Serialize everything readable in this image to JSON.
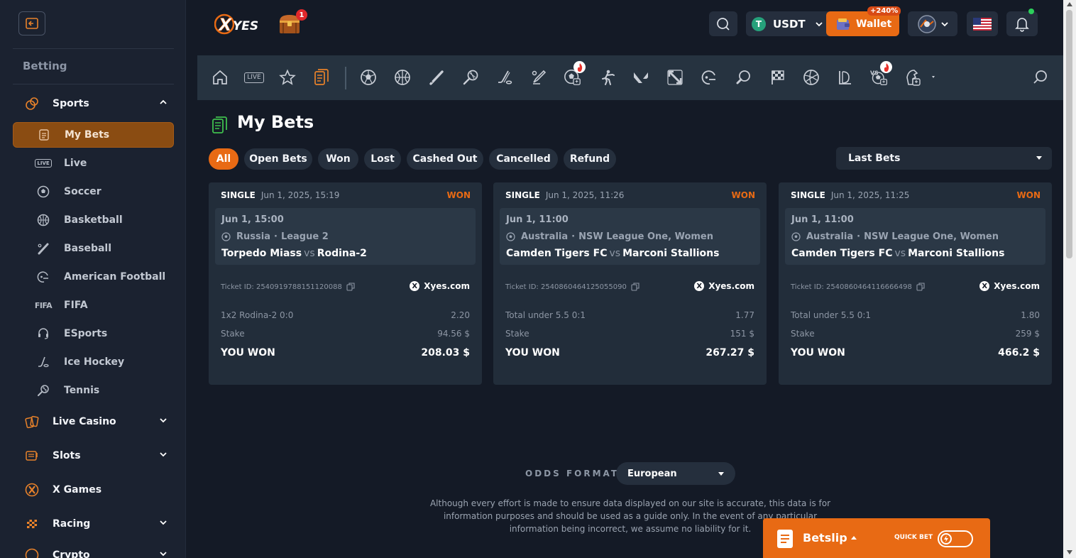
{
  "brand": {
    "logo_text": "XYES",
    "chest_badge": "1"
  },
  "sidebar": {
    "heading": "Betting",
    "sports_group": {
      "label": "Sports",
      "icon": "sports-icon",
      "expanded": true
    },
    "sport_items": [
      {
        "label": "My Bets",
        "icon": "bets-icon",
        "active": true
      },
      {
        "label": "Live",
        "icon": "live-icon",
        "badge": "LIVE"
      },
      {
        "label": "Soccer",
        "icon": "soccer-icon"
      },
      {
        "label": "Basketball",
        "icon": "basketball-icon"
      },
      {
        "label": "Baseball",
        "icon": "baseball-icon"
      },
      {
        "label": "American Football",
        "icon": "american-football-icon"
      },
      {
        "label": "FIFA",
        "icon": "fifa-icon",
        "badge": "FIFA"
      },
      {
        "label": "ESports",
        "icon": "esports-icon"
      },
      {
        "label": "Ice Hockey",
        "icon": "ice-hockey-icon"
      },
      {
        "label": "Tennis",
        "icon": "tennis-icon"
      }
    ],
    "groups": [
      {
        "label": "Live Casino",
        "icon": "live-casino-icon",
        "chevron": true
      },
      {
        "label": "Slots",
        "icon": "slots-icon",
        "chevron": true
      },
      {
        "label": "X Games",
        "icon": "x-games-icon",
        "chevron": false
      },
      {
        "label": "Racing",
        "icon": "racing-icon",
        "chevron": true
      },
      {
        "label": "Crypto",
        "icon": "crypto-icon",
        "chevron": true
      }
    ]
  },
  "topbar": {
    "currency": "USDT",
    "currency_symbol": "T",
    "wallet_label": "Wallet",
    "wallet_bonus": "+240%",
    "accent": "#e86a14"
  },
  "sports_bar": {
    "items": [
      "home-icon",
      "live-icon",
      "favorites-icon",
      "my-bets-icon",
      "soccer-icon",
      "basketball-icon",
      "baseball-icon",
      "tennis-icon",
      "ice-hockey-icon",
      "cricket-icon",
      "virtual-soccer-icon",
      "shooter-icon",
      "valorant-icon",
      "dota-icon",
      "american-football-icon",
      "table-tennis-icon",
      "racing-flag-icon",
      "volleyball-icon",
      "handball-icon",
      "virtual-sports-icon",
      "more-sports-icon"
    ],
    "live_label": "LIVE"
  },
  "page": {
    "title": "My Bets",
    "filters": [
      "All",
      "Open Bets",
      "Won",
      "Lost",
      "Cashed Out",
      "Cancelled",
      "Refund"
    ],
    "active_filter": "All",
    "period_select": "Last Bets"
  },
  "bets": [
    {
      "type": "SINGLE",
      "placed": "Jun 1, 2025, 15:19",
      "status": "WON",
      "event_time": "Jun 1, 15:00",
      "country": "Russia",
      "league": "League 2",
      "home": "Torpedo Miass",
      "vs": "vs",
      "away": "Rodina-2",
      "ticket": "Ticket ID: 2540919788151120088",
      "site": "Xyes.com",
      "selection": "1x2 Rodina-2   0:0",
      "odds": "2.20",
      "stake_label": "Stake",
      "stake": "94.56 $",
      "result_label": "YOU WON",
      "payout": "208.03 $"
    },
    {
      "type": "SINGLE",
      "placed": "Jun 1, 2025, 11:26",
      "status": "WON",
      "event_time": "Jun 1, 11:00",
      "country": "Australia",
      "league": "NSW League One, Women",
      "home": "Camden Tigers FC",
      "vs": "vs",
      "away": "Marconi Stallions",
      "ticket": "Ticket ID: 2540860464125055090",
      "site": "Xyes.com",
      "selection": "Total under 5.5   0:1",
      "odds": "1.77",
      "stake_label": "Stake",
      "stake": "151 $",
      "result_label": "YOU WON",
      "payout": "267.27 $"
    },
    {
      "type": "SINGLE",
      "placed": "Jun 1, 2025, 11:25",
      "status": "WON",
      "event_time": "Jun 1, 11:00",
      "country": "Australia",
      "league": "NSW League One, Women",
      "home": "Camden Tigers FC",
      "vs": "vs",
      "away": "Marconi Stallions",
      "ticket": "Ticket ID: 2540860464116666498",
      "site": "Xyes.com",
      "selection": "Total under 5.5   0:1",
      "odds": "1.80",
      "stake_label": "Stake",
      "stake": "259 $",
      "result_label": "YOU WON",
      "payout": "466.2 $"
    }
  ],
  "footer": {
    "odds_label": "ODDS FORMAT",
    "odds_value": "European",
    "disclaimer": "Although every effort is made to ensure data displayed on our site is accurate, this data is for information purposes and should be used as a guide only. In the event of any particular information being incorrect, we assume no liability for it."
  },
  "betslip": {
    "label": "Betslip",
    "quick_bet": "QUICK BET"
  }
}
